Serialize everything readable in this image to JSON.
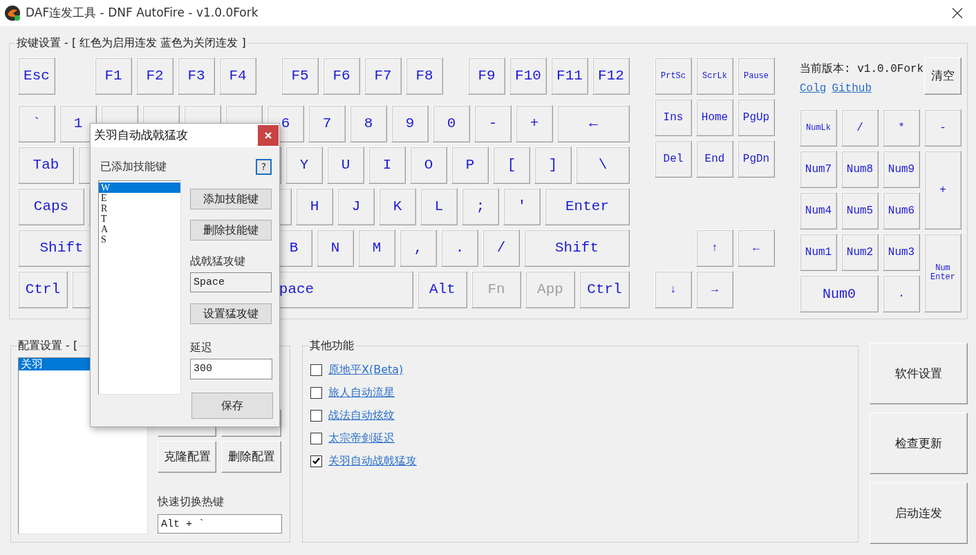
{
  "window": {
    "title": "DAF连发工具 - DNF AutoFire - v1.0.0Fork"
  },
  "keyboard": {
    "title": "按键设置 - [ 红色为启用连发 蓝色为关闭连发 ]",
    "main_rows": [
      [
        {
          "label": "Esc",
          "autofire": false,
          "disabled": false
        },
        {
          "label": "F1",
          "autofire": false,
          "disabled": false
        },
        {
          "label": "F2",
          "autofire": false,
          "disabled": false
        },
        {
          "label": "F3",
          "autofire": false,
          "disabled": false
        },
        {
          "label": "F4",
          "autofire": false,
          "disabled": false
        },
        {
          "label": "F5",
          "autofire": false,
          "disabled": false
        },
        {
          "label": "F6",
          "autofire": false,
          "disabled": false
        },
        {
          "label": "F7",
          "autofire": false,
          "disabled": false
        },
        {
          "label": "F8",
          "autofire": false,
          "disabled": false
        },
        {
          "label": "F9",
          "autofire": false,
          "disabled": false
        },
        {
          "label": "F10",
          "autofire": false,
          "disabled": false
        },
        {
          "label": "F11",
          "autofire": false,
          "disabled": false
        },
        {
          "label": "F12",
          "autofire": false,
          "disabled": false
        }
      ],
      [
        {
          "label": "`",
          "autofire": false,
          "disabled": false
        },
        {
          "label": "1",
          "autofire": false,
          "disabled": false
        },
        {
          "label": "6",
          "autofire": false,
          "disabled": false
        },
        {
          "label": "7",
          "autofire": false,
          "disabled": false
        },
        {
          "label": "8",
          "autofire": false,
          "disabled": false
        },
        {
          "label": "9",
          "autofire": false,
          "disabled": false
        },
        {
          "label": "0",
          "autofire": false,
          "disabled": false
        },
        {
          "label": "-",
          "autofire": false,
          "disabled": false
        },
        {
          "label": "+",
          "autofire": false,
          "disabled": false
        },
        {
          "label": "←",
          "autofire": false,
          "disabled": false
        }
      ],
      [
        {
          "label": "Tab",
          "autofire": false,
          "disabled": false
        },
        {
          "label": "Y",
          "autofire": false,
          "disabled": false
        },
        {
          "label": "U",
          "autofire": false,
          "disabled": false
        },
        {
          "label": "I",
          "autofire": false,
          "disabled": false
        },
        {
          "label": "O",
          "autofire": false,
          "disabled": false
        },
        {
          "label": "P",
          "autofire": false,
          "disabled": false
        },
        {
          "label": "[",
          "autofire": false,
          "disabled": false
        },
        {
          "label": "]",
          "autofire": false,
          "disabled": false
        },
        {
          "label": "\\",
          "autofire": false,
          "disabled": false
        }
      ],
      [
        {
          "label": "Caps",
          "autofire": false,
          "disabled": false
        },
        {
          "label": "H",
          "autofire": false,
          "disabled": false
        },
        {
          "label": "J",
          "autofire": false,
          "disabled": false
        },
        {
          "label": "K",
          "autofire": false,
          "disabled": false
        },
        {
          "label": "L",
          "autofire": false,
          "disabled": false
        },
        {
          "label": ";",
          "autofire": false,
          "disabled": false
        },
        {
          "label": "'",
          "autofire": false,
          "disabled": false
        },
        {
          "label": "Enter",
          "autofire": false,
          "disabled": false
        }
      ],
      [
        {
          "label": "Shift",
          "autofire": false,
          "disabled": false
        },
        {
          "label": "B",
          "autofire": false,
          "disabled": false
        },
        {
          "label": "N",
          "autofire": false,
          "disabled": false
        },
        {
          "label": "M",
          "autofire": false,
          "disabled": false
        },
        {
          "label": ",",
          "autofire": false,
          "disabled": false
        },
        {
          "label": ".",
          "autofire": false,
          "disabled": false
        },
        {
          "label": "/",
          "autofire": false,
          "disabled": false
        },
        {
          "label": "Shift",
          "autofire": false,
          "disabled": false
        }
      ],
      [
        {
          "label": "Ctrl",
          "autofire": false,
          "disabled": false
        },
        {
          "label": "pace",
          "autofire": false,
          "disabled": false
        },
        {
          "label": "Alt",
          "autofire": false,
          "disabled": false
        },
        {
          "label": "Fn",
          "autofire": false,
          "disabled": true
        },
        {
          "label": "App",
          "autofire": false,
          "disabled": true
        },
        {
          "label": "Ctrl",
          "autofire": false,
          "disabled": false
        }
      ]
    ],
    "nav_keys": [
      {
        "label": "PrtSc",
        "autofire": false,
        "disabled": false
      },
      {
        "label": "ScrLk",
        "autofire": false,
        "disabled": false
      },
      {
        "label": "Pause",
        "autofire": false,
        "disabled": false
      },
      {
        "label": "Ins",
        "autofire": false,
        "disabled": false
      },
      {
        "label": "Home",
        "autofire": false,
        "disabled": false
      },
      {
        "label": "PgUp",
        "autofire": false,
        "disabled": false
      },
      {
        "label": "Del",
        "autofire": false,
        "disabled": false
      },
      {
        "label": "End",
        "autofire": false,
        "disabled": false
      },
      {
        "label": "PgDn",
        "autofire": false,
        "disabled": false
      }
    ],
    "arrow_keys": [
      {
        "label": "↑",
        "autofire": false,
        "disabled": false
      },
      {
        "label": "←",
        "autofire": false,
        "disabled": false
      },
      {
        "label": "↓",
        "autofire": false,
        "disabled": false
      },
      {
        "label": "→",
        "autofire": false,
        "disabled": false
      }
    ],
    "numpad": [
      {
        "label": "NumLk",
        "autofire": false,
        "disabled": false
      },
      {
        "label": "/",
        "autofire": false,
        "disabled": false
      },
      {
        "label": "*",
        "autofire": false,
        "disabled": false
      },
      {
        "label": "-",
        "autofire": false,
        "disabled": false
      },
      {
        "label": "Num7",
        "autofire": false,
        "disabled": false
      },
      {
        "label": "Num8",
        "autofire": false,
        "disabled": false
      },
      {
        "label": "Num9",
        "autofire": false,
        "disabled": false
      },
      {
        "label": "+",
        "autofire": false,
        "disabled": false
      },
      {
        "label": "Num4",
        "autofire": false,
        "disabled": false
      },
      {
        "label": "Num5",
        "autofire": false,
        "disabled": false
      },
      {
        "label": "Num6",
        "autofire": false,
        "disabled": false
      },
      {
        "label": "Num1",
        "autofire": false,
        "disabled": false
      },
      {
        "label": "Num2",
        "autofire": false,
        "disabled": false
      },
      {
        "label": "Num3",
        "autofire": false,
        "disabled": false
      },
      {
        "label": "Num Enter",
        "autofire": false,
        "disabled": false
      },
      {
        "label": "Num0",
        "autofire": false,
        "disabled": false
      },
      {
        "label": ".",
        "autofire": false,
        "disabled": false
      }
    ]
  },
  "version": {
    "text": "当前版本: v1.0.0Fork",
    "links": [
      "Colg",
      "Github"
    ],
    "clear_button": "清空"
  },
  "config": {
    "title": "配置设置 - [",
    "profiles": [
      {
        "name": "关羽",
        "selected": true
      }
    ],
    "buttons": [
      "克隆配置",
      "删除配置"
    ],
    "hotkey_label": "快速切换热键",
    "hotkey_value": "Alt + `"
  },
  "other": {
    "title": "其他功能",
    "options": [
      {
        "label": "原地平X(Beta)",
        "checked": false
      },
      {
        "label": "旅人自动流星",
        "checked": false
      },
      {
        "label": "战法自动炫纹",
        "checked": false
      },
      {
        "label": "太宗帝剑延迟",
        "checked": false
      },
      {
        "label": "关羽自动战戟猛攻",
        "checked": true
      }
    ]
  },
  "actions": [
    "软件设置",
    "检查更新",
    "启动连发"
  ],
  "dialog": {
    "title": "关羽自动战戟猛攻",
    "list_label": "已添加技能键",
    "help": "?",
    "skills": [
      {
        "label": "W",
        "selected": true
      },
      {
        "label": "E",
        "selected": false
      },
      {
        "label": "R",
        "selected": false
      },
      {
        "label": "T",
        "selected": false
      },
      {
        "label": "A",
        "selected": false
      },
      {
        "label": "S",
        "selected": false
      }
    ],
    "add_button": "添加技能键",
    "remove_button": "删除技能键",
    "attack_label": "战戟猛攻键",
    "attack_value": "Space",
    "set_button": "设置猛攻键",
    "delay_label": "延迟",
    "delay_value": "300",
    "save_button": "保存"
  }
}
